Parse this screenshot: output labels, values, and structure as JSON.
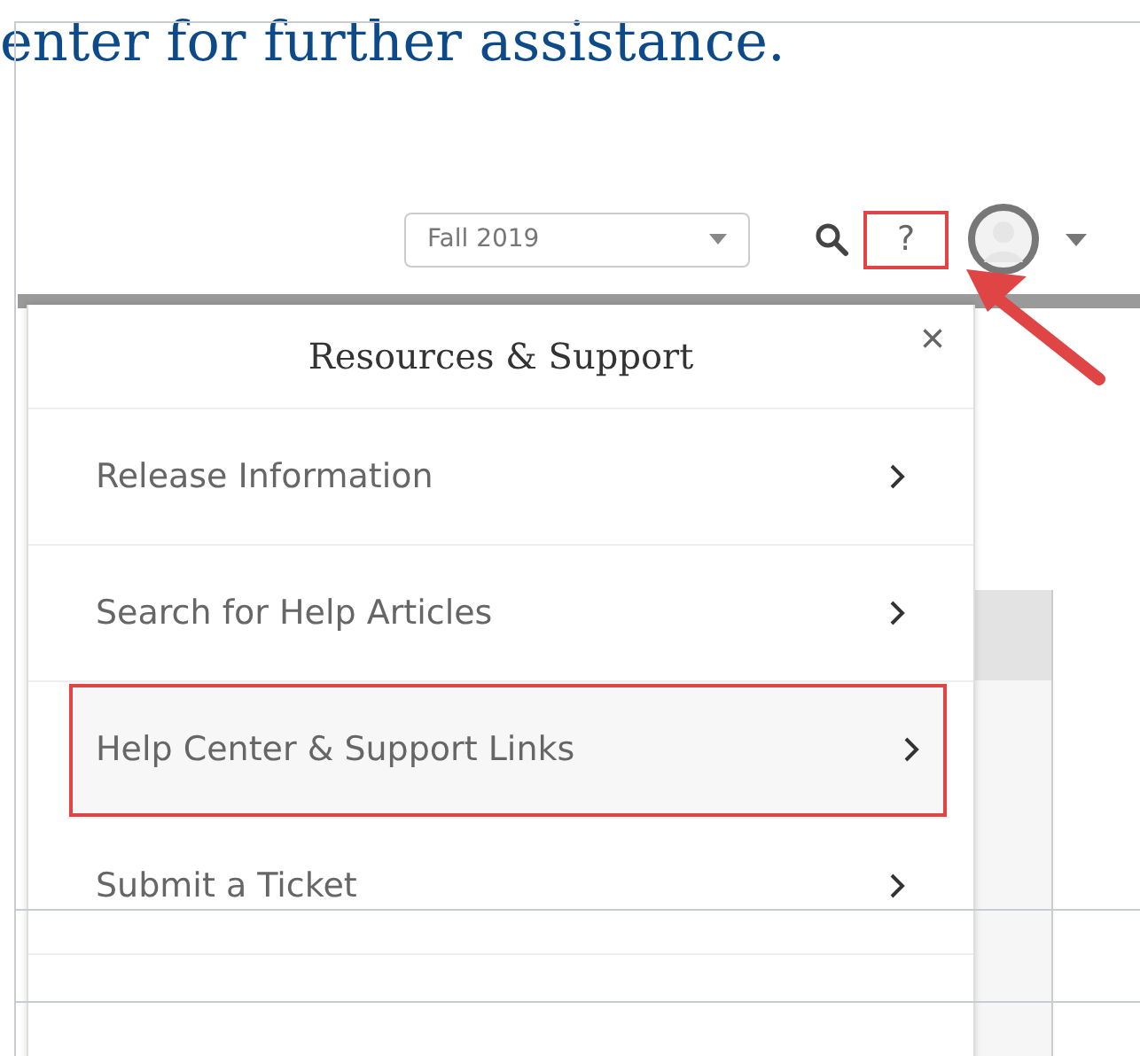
{
  "heading": "enter for further assistance.",
  "toolbar": {
    "term_select": {
      "value": "Fall 2019"
    },
    "help_button": {
      "label": "?",
      "highlighted": true
    }
  },
  "panel": {
    "title": "Resources & Support",
    "close": "×",
    "items": [
      {
        "label": "Release Information",
        "highlighted": false
      },
      {
        "label": "Search for Help Articles",
        "highlighted": false
      },
      {
        "label": "Help Center & Support Links",
        "highlighted": true
      },
      {
        "label": "Submit a Ticket",
        "highlighted": false
      }
    ]
  }
}
